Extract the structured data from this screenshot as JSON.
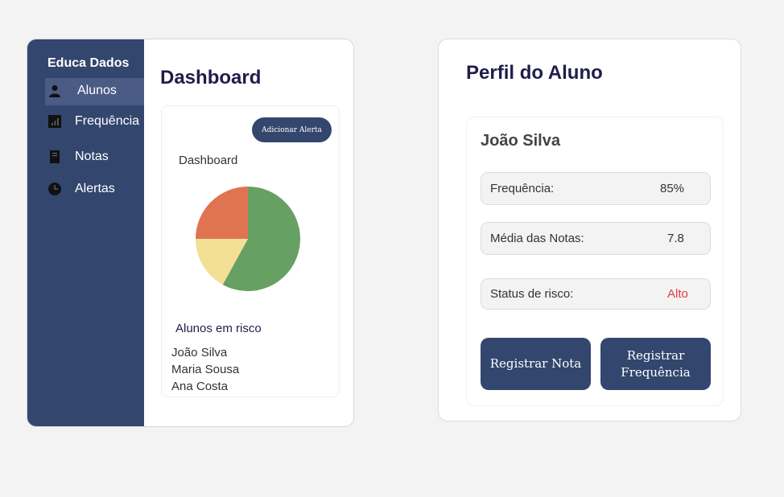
{
  "sidebar": {
    "brand": "Educa Dados",
    "items": [
      {
        "label": "Alunos",
        "icon": "person-icon"
      },
      {
        "label": "Frequência",
        "icon": "bar-chart-icon"
      },
      {
        "label": "Notas",
        "icon": "notebook-icon"
      },
      {
        "label": "Alertas",
        "icon": "clock-icon"
      }
    ]
  },
  "dashboard": {
    "title": "Dashboard",
    "add_alert_label": "Adicionar Alerta",
    "chart_title": "Dashboard",
    "risk_title": "Alunos em risco",
    "risk_students": [
      "João Silva",
      "Maria Sousa",
      "Ana Costa"
    ]
  },
  "chart_data": {
    "type": "pie",
    "title": "Dashboard",
    "values": [
      58,
      17,
      25
    ],
    "colors": [
      "#66a062",
      "#f3df96",
      "#e07452"
    ]
  },
  "profile": {
    "title": "Perfil do Aluno",
    "student_name": "João Silva",
    "fields": [
      {
        "label": "Frequência:",
        "value": "85%"
      },
      {
        "label": "Média das Notas:",
        "value": "7.8"
      },
      {
        "label": "Status de risco:",
        "value": "Alto"
      }
    ],
    "buttons": {
      "register_grade": "Registrar Nota",
      "register_attendance": "Registrar Frequência"
    }
  },
  "colors": {
    "primary": "#33466e",
    "sidebar_active": "#4a5c86",
    "danger": "#e53b3b",
    "heading": "#1f1d4a"
  }
}
